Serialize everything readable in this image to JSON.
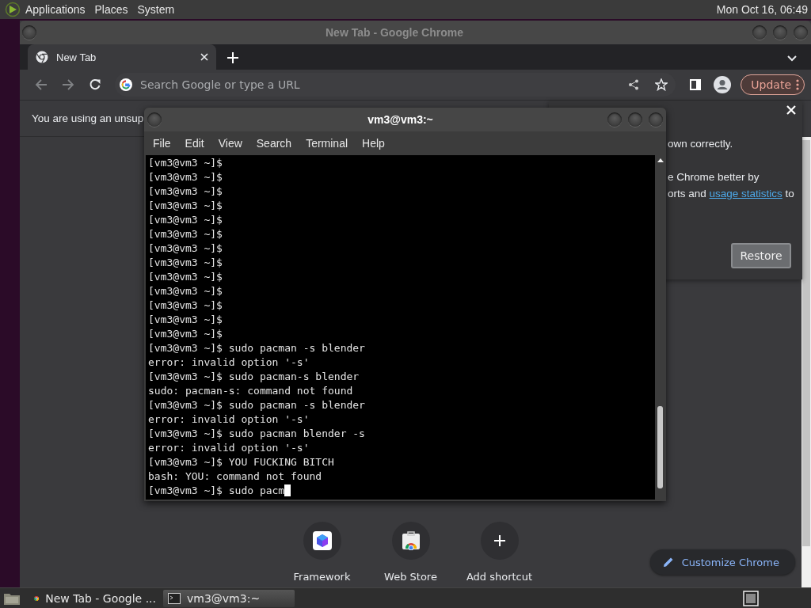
{
  "top_panel": {
    "menus": [
      "Applications",
      "Places",
      "System"
    ],
    "clock": "Mon Oct 16, 06:49"
  },
  "chrome": {
    "title": "New Tab - Google Chrome",
    "tabs": [
      {
        "label": "New Tab",
        "selected": true
      }
    ],
    "address": {
      "placeholder": "Search Google or type a URL"
    },
    "update_button": "Update",
    "infobar": "You are using an unsup",
    "dialog": {
      "line_1": "own correctly.",
      "line_2": "e Chrome better by",
      "line_3_before": "orts and ",
      "link": "usage statistics",
      "line_3_after": " to",
      "button": "Restore"
    },
    "shortcuts": [
      {
        "label": "Framework",
        "kind": "framework"
      },
      {
        "label": "Web Store",
        "kind": "store"
      },
      {
        "label": "Add shortcut",
        "kind": "add"
      }
    ],
    "customize_button": "Customize Chrome"
  },
  "terminal": {
    "title": "vm3@vm3:~",
    "menus": [
      "File",
      "Edit",
      "View",
      "Search",
      "Terminal",
      "Help"
    ],
    "lines": [
      "[vm3@vm3 ~]$",
      "[vm3@vm3 ~]$",
      "[vm3@vm3 ~]$",
      "[vm3@vm3 ~]$",
      "[vm3@vm3 ~]$",
      "[vm3@vm3 ~]$",
      "[vm3@vm3 ~]$",
      "[vm3@vm3 ~]$",
      "[vm3@vm3 ~]$",
      "[vm3@vm3 ~]$",
      "[vm3@vm3 ~]$",
      "[vm3@vm3 ~]$",
      "[vm3@vm3 ~]$",
      "[vm3@vm3 ~]$ sudo pacman -s blender",
      "error: invalid option '-s'",
      "[vm3@vm3 ~]$ sudo pacman-s blender",
      "sudo: pacman-s: command not found",
      "[vm3@vm3 ~]$ sudo pacman -s blender",
      "error: invalid option '-s'",
      "[vm3@vm3 ~]$ sudo pacman blender -s",
      "error: invalid option '-s'",
      "[vm3@vm3 ~]$ YOU FUCKING BITCH",
      "bash: YOU: command not found",
      "[vm3@vm3 ~]$ sudo pacm"
    ],
    "cursor": true
  },
  "taskbar": {
    "items": [
      {
        "label": "New Tab - Google ...",
        "kind": "chrome",
        "selected": false
      },
      {
        "label": "vm3@vm3:~",
        "kind": "terminal",
        "selected": true
      }
    ]
  }
}
